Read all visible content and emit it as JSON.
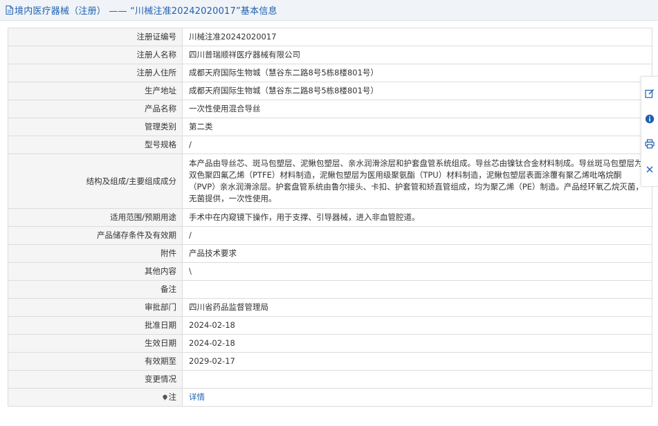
{
  "header": {
    "title": "境内医疗器械（注册） —— “川械注准20242020017”基本信息"
  },
  "rows": [
    {
      "label": "注册证编号",
      "value": "川械注准20242020017"
    },
    {
      "label": "注册人名称",
      "value": "四川普瑞顺祥医疗器械有限公司"
    },
    {
      "label": "注册人住所",
      "value": "成都天府国际生物城（慧谷东二路8号5栋8楼801号）"
    },
    {
      "label": "生产地址",
      "value": "成都天府国际生物城（慧谷东二路8号5栋8楼801号）"
    },
    {
      "label": "产品名称",
      "value": "一次性使用混合导丝"
    },
    {
      "label": "管理类别",
      "value": "第二类"
    },
    {
      "label": "型号规格",
      "value": "/"
    },
    {
      "label": "结构及组成/主要组成成分",
      "value": "本产品由导丝芯、斑马包塑层、泥鳅包塑层、亲水润滑涂层和护套盘管系统组成。导丝芯由镍钛合金材料制成。导丝斑马包塑层为双色聚四氟乙烯（PTFE）材料制造，泥鳅包塑层为医用级聚氨酯（TPU）材料制造，泥鳅包塑层表面涂覆有聚乙烯吡咯烷酮（PVP）亲水润滑涂层。护套盘管系统由鲁尔接头、卡扣、护套管和矫直管组成，均为聚乙烯（PE）制造。产品经环氧乙烷灭菌，无菌提供，一次性使用。"
    },
    {
      "label": "适用范围/预期用途",
      "value": "手术中在内窥镜下操作，用于支撑、引导器械，进入非血管腔道。"
    },
    {
      "label": "产品储存条件及有效期",
      "value": "/"
    },
    {
      "label": "附件",
      "value": "产品技术要求"
    },
    {
      "label": "其他内容",
      "value": "\\"
    },
    {
      "label": "备注",
      "value": ""
    },
    {
      "label": "审批部门",
      "value": "四川省药品监督管理局"
    },
    {
      "label": "批准日期",
      "value": "2024-02-18"
    },
    {
      "label": "生效日期",
      "value": "2024-02-18"
    },
    {
      "label": "有效期至",
      "value": "2029-02-17"
    },
    {
      "label": "变更情况",
      "value": ""
    }
  ],
  "note_row": {
    "label": "注",
    "link": "详情"
  },
  "toolbar": {
    "icons": [
      "edit-icon",
      "info-icon",
      "print-icon",
      "close-icon"
    ]
  },
  "colors": {
    "accent": "#1f5fb0",
    "label_bg": "#f5f5f5",
    "border": "#dcdcdc",
    "header_bg": "#f0f3f7"
  }
}
